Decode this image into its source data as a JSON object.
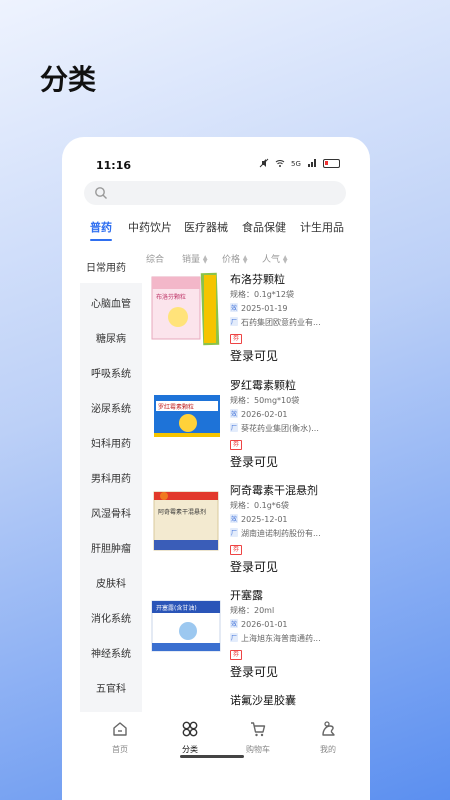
{
  "hero_title": "分类",
  "status_bar": {
    "time": "11:16"
  },
  "search": {
    "placeholder": ""
  },
  "tabs": [
    {
      "label": "普药",
      "active": true
    },
    {
      "label": "中药饮片"
    },
    {
      "label": "医疗器械"
    },
    {
      "label": "食品保健"
    },
    {
      "label": "计生用品"
    }
  ],
  "sidebar": {
    "items": [
      "日常用药",
      "心脑血管",
      "糖尿病",
      "呼吸系统",
      "泌尿系统",
      "妇科用药",
      "男科用药",
      "风湿骨科",
      "肝胆肿瘤",
      "皮肤科",
      "消化系统",
      "神经系统",
      "五官科"
    ]
  },
  "sort_bar": {
    "comprehensive": "综合",
    "sales": "销量",
    "price": "价格",
    "popularity": "人气"
  },
  "products": [
    {
      "name": "布洛芬颗粒",
      "spec": "规格：0.1g*12袋",
      "date": "2025-01-19",
      "maker": "石药集团欧意药业有...",
      "badge": "券",
      "price_text": "登录可见",
      "box_label": "布洛芬颗粒"
    },
    {
      "name": "罗红霉素颗粒",
      "spec": "规格：50mg*10袋",
      "date": "2026-02-01",
      "maker": "葵花药业集团(衡水)...",
      "badge": "券",
      "price_text": "登录可见",
      "box_label": "罗红霉素颗粒"
    },
    {
      "name": "阿奇霉素干混悬剂",
      "spec": "规格：0.1g*6袋",
      "date": "2025-12-01",
      "maker": "湖南迪诺制药股份有...",
      "badge": "券",
      "price_text": "登录可见",
      "box_label": "阿奇霉素干混悬剂"
    },
    {
      "name": "开塞露",
      "spec": "规格：20ml",
      "date": "2026-01-01",
      "maker": "上海旭东海普南通药...",
      "badge": "券",
      "price_text": "登录可见",
      "box_label": "开塞露(含甘油)"
    },
    {
      "name": "诺氟沙星胶囊"
    }
  ],
  "tag_date": "效",
  "tag_maker": "厂",
  "bottom_nav": [
    {
      "label": "首页",
      "icon": "home-icon"
    },
    {
      "label": "分类",
      "icon": "category-icon",
      "active": true
    },
    {
      "label": "购物车",
      "icon": "cart-icon"
    },
    {
      "label": "我的",
      "icon": "profile-icon"
    }
  ],
  "colors": {
    "accent": "#2f6ff0",
    "badge": "#e44444"
  }
}
